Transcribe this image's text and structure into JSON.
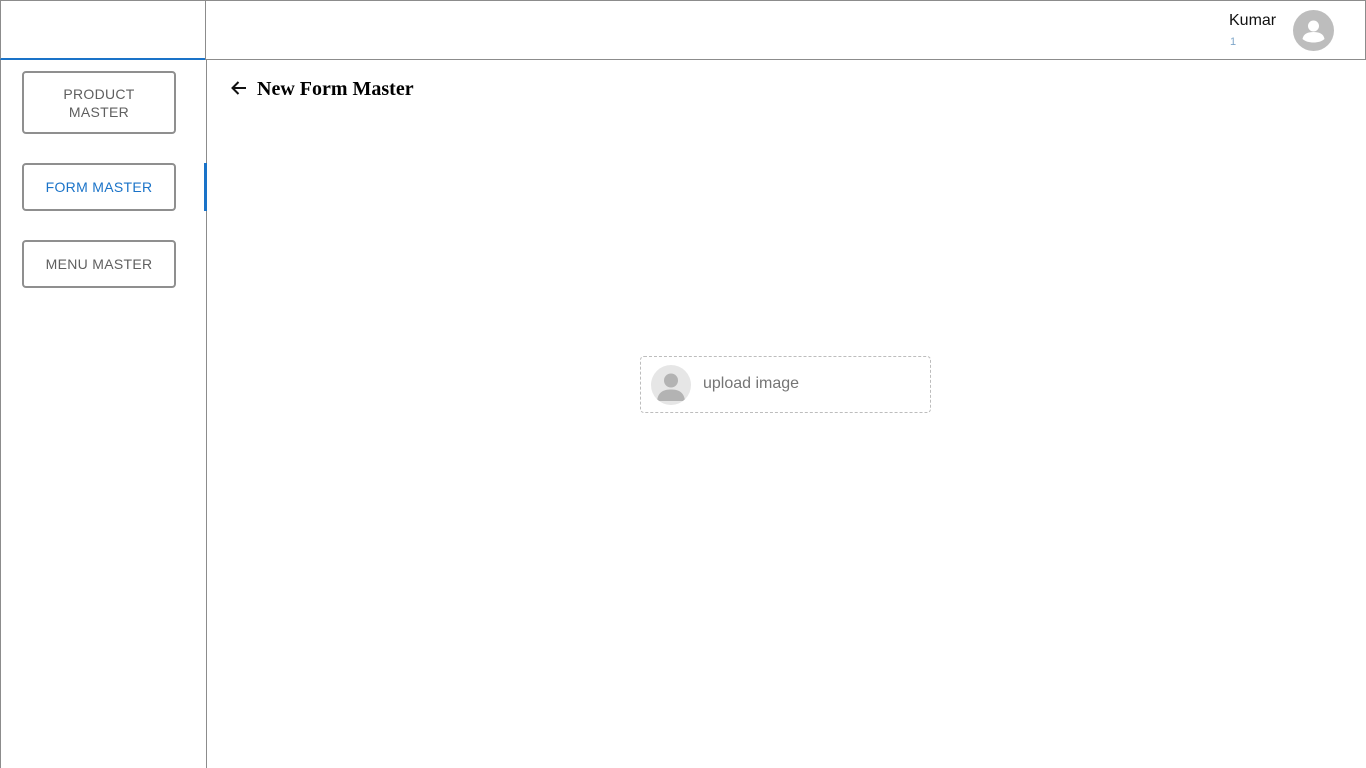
{
  "sidebar": {
    "items": [
      {
        "label": "PRODUCT MASTER",
        "active": false
      },
      {
        "label": "FORM MASTER",
        "active": true
      },
      {
        "label": "MENU MASTER",
        "active": false
      }
    ]
  },
  "header": {
    "user": {
      "name": "Kumar",
      "sub": "1",
      "avatar_icon": "account-circle-icon"
    }
  },
  "main": {
    "back_icon": "arrow-left-icon",
    "title": "New Form Master",
    "upload": {
      "label": "upload image",
      "icon": "person-placeholder-icon"
    }
  },
  "colors": {
    "accent": "#1a73c8",
    "border": "#8c8c8c",
    "muted_text": "#757575",
    "avatar_bg": "#bdbdbd"
  }
}
